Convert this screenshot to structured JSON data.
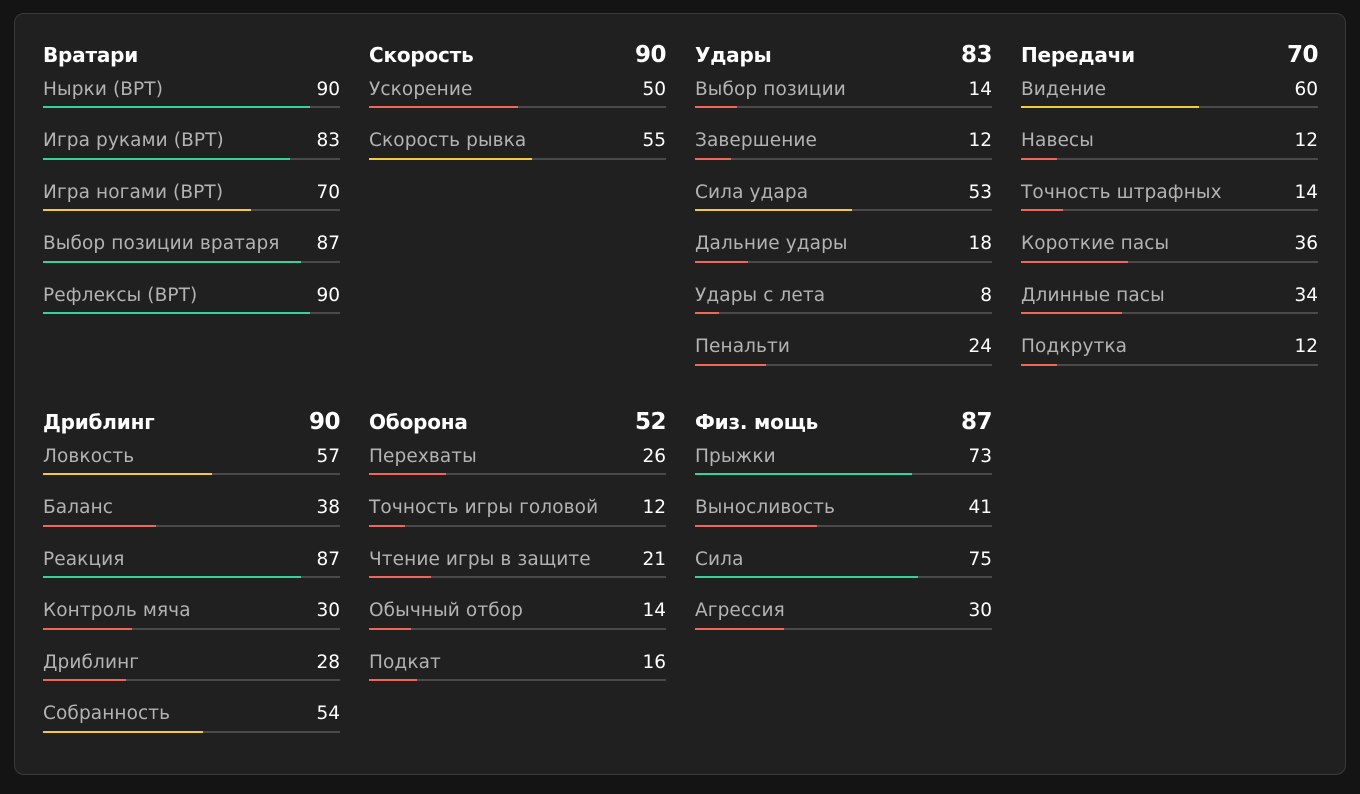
{
  "colors": {
    "high": "#34d399",
    "mid": "#f5c842",
    "low": "#f0675a",
    "track": "#4a4a4a"
  },
  "groups": [
    {
      "title": "Вратари",
      "score": "",
      "stats": [
        {
          "label": "Нырки (ВРТ)",
          "value": 90,
          "tier": "high"
        },
        {
          "label": "Игра руками (ВРТ)",
          "value": 83,
          "tier": "high"
        },
        {
          "label": "Игра ногами (ВРТ)",
          "value": 70,
          "tier": "mid"
        },
        {
          "label": "Выбор позиции вратаря",
          "value": 87,
          "tier": "high"
        },
        {
          "label": "Рефлексы (ВРТ)",
          "value": 90,
          "tier": "high"
        }
      ]
    },
    {
      "title": "Скорость",
      "score": "90",
      "stats": [
        {
          "label": "Ускорение",
          "value": 50,
          "tier": "low"
        },
        {
          "label": "Скорость рывка",
          "value": 55,
          "tier": "mid"
        }
      ]
    },
    {
      "title": "Удары",
      "score": "83",
      "stats": [
        {
          "label": "Выбор позиции",
          "value": 14,
          "tier": "low"
        },
        {
          "label": "Завершение",
          "value": 12,
          "tier": "low"
        },
        {
          "label": "Сила удара",
          "value": 53,
          "tier": "mid"
        },
        {
          "label": "Дальние удары",
          "value": 18,
          "tier": "low"
        },
        {
          "label": "Удары с лета",
          "value": 8,
          "tier": "low"
        },
        {
          "label": "Пенальти",
          "value": 24,
          "tier": "low"
        }
      ]
    },
    {
      "title": "Передачи",
      "score": "70",
      "stats": [
        {
          "label": "Видение",
          "value": 60,
          "tier": "mid"
        },
        {
          "label": "Навесы",
          "value": 12,
          "tier": "low"
        },
        {
          "label": "Точность штрафных",
          "value": 14,
          "tier": "low"
        },
        {
          "label": "Короткие пасы",
          "value": 36,
          "tier": "low"
        },
        {
          "label": "Длинные пасы",
          "value": 34,
          "tier": "low"
        },
        {
          "label": "Подкрутка",
          "value": 12,
          "tier": "low"
        }
      ]
    },
    {
      "title": "Дриблинг",
      "score": "90",
      "stats": [
        {
          "label": "Ловкость",
          "value": 57,
          "tier": "mid"
        },
        {
          "label": "Баланс",
          "value": 38,
          "tier": "low"
        },
        {
          "label": "Реакция",
          "value": 87,
          "tier": "high"
        },
        {
          "label": "Контроль мяча",
          "value": 30,
          "tier": "low"
        },
        {
          "label": "Дриблинг",
          "value": 28,
          "tier": "low"
        },
        {
          "label": "Собранность",
          "value": 54,
          "tier": "mid"
        }
      ]
    },
    {
      "title": "Оборона",
      "score": "52",
      "stats": [
        {
          "label": "Перехваты",
          "value": 26,
          "tier": "low"
        },
        {
          "label": "Точность игры головой",
          "value": 12,
          "tier": "low"
        },
        {
          "label": "Чтение игры в защите",
          "value": 21,
          "tier": "low"
        },
        {
          "label": "Обычный отбор",
          "value": 14,
          "tier": "low"
        },
        {
          "label": "Подкат",
          "value": 16,
          "tier": "low"
        }
      ]
    },
    {
      "title": "Физ. мощь",
      "score": "87",
      "stats": [
        {
          "label": "Прыжки",
          "value": 73,
          "tier": "high"
        },
        {
          "label": "Выносливость",
          "value": 41,
          "tier": "low"
        },
        {
          "label": "Сила",
          "value": 75,
          "tier": "high"
        },
        {
          "label": "Агрессия",
          "value": 30,
          "tier": "low"
        }
      ]
    }
  ]
}
